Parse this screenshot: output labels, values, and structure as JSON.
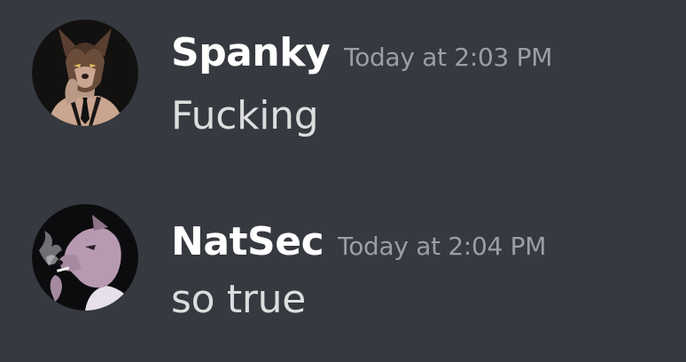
{
  "messages": [
    {
      "username": "Spanky",
      "timestamp": "Today at 2:03 PM",
      "content": "Fucking",
      "avatar_icon": "wolf-avatar"
    },
    {
      "username": "NatSec",
      "timestamp": "Today at 2:04 PM",
      "content": "so true",
      "avatar_icon": "smoking-dog-avatar"
    }
  ],
  "colors": {
    "background": "#36393f",
    "username": "#ffffff",
    "timestamp": "#9b9fa5",
    "content": "#dcddde"
  }
}
